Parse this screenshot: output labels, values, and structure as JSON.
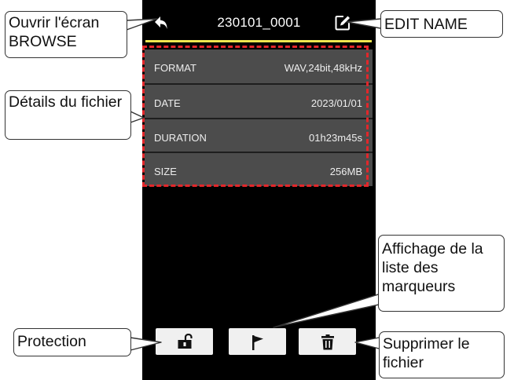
{
  "header": {
    "title": "230101_0001"
  },
  "details": [
    {
      "key": "FORMAT",
      "value": "WAV,24bit,48kHz"
    },
    {
      "key": "DATE",
      "value": "2023/01/01"
    },
    {
      "key": "DURATION",
      "value": "01h23m45s"
    },
    {
      "key": "SIZE",
      "value": "256MB"
    }
  ],
  "callouts": {
    "browse": "Ouvrir l'écran BROWSE",
    "edit_name": "EDIT NAME",
    "details": "Détails du fichier",
    "markers": "Affichage de la liste des marqueurs",
    "protection": "Protection",
    "delete": "Supprimer le fichier"
  },
  "icons": {
    "back": "back-arrow-icon",
    "edit": "edit-icon",
    "protect": "unlock-icon",
    "marker": "flag-icon",
    "delete": "trash-icon"
  },
  "colors": {
    "accent_line": "#efe64f",
    "highlight_dash": "#e3262a",
    "panel": "#4c4c4c",
    "background": "#000000"
  }
}
